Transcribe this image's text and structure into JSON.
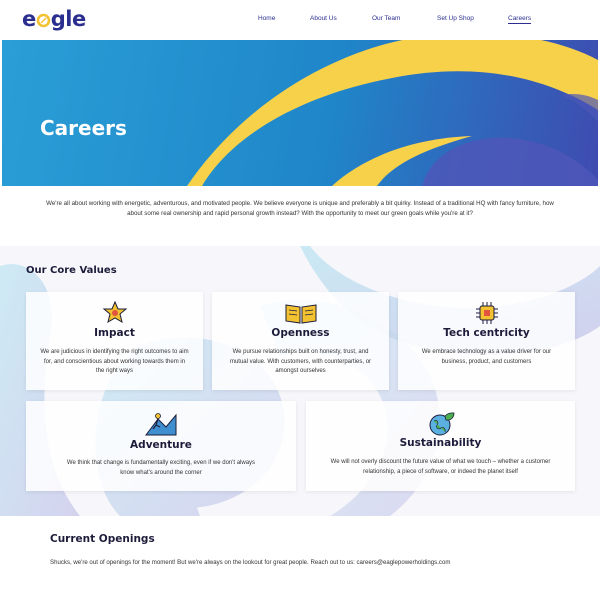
{
  "brand": {
    "logo_text_1": "e",
    "logo_text_2": "g",
    "logo_text_3": "le"
  },
  "nav": {
    "items": [
      {
        "label": "Home"
      },
      {
        "label": "About Us"
      },
      {
        "label": "Our Team"
      },
      {
        "label": "Set Up Shop"
      },
      {
        "label": "Careers",
        "active": true
      }
    ]
  },
  "hero": {
    "title": "Careers"
  },
  "intro": {
    "text": "We're all about working with energetic, adventurous, and motivated people. We believe everyone is unique and preferably a bit quirky. Instead of a traditional HQ with fancy furniture, how about some real ownership and rapid personal growth instead? With the opportunity to meet our green goals while you're at it?"
  },
  "core_values": {
    "title": "Our Core Values",
    "cards": [
      {
        "icon": "trophy-star-icon",
        "title": "Impact",
        "text": "We are judicious in identifying the right outcomes to aim for, and conscientious about working towards them in the right ways"
      },
      {
        "icon": "open-book-icon",
        "title": "Openness",
        "text": "We pursue relationships built on honesty, trust, and mutual value. With customers, with counterparties, or amongst ourselves"
      },
      {
        "icon": "microchip-icon",
        "title": "Tech centricity",
        "text": "We embrace technology as a value driver for our business, product, and customers"
      },
      {
        "icon": "climber-icon",
        "title": "Adventure",
        "text": "We think that change is fundamentally exciting, even if we don't always know what's around the corner"
      },
      {
        "icon": "globe-leaf-icon",
        "title": "Sustainability",
        "text": "We will not overly discount the future value of what we touch – whether a customer relationship, a piece of software, or indeed the planet itself"
      }
    ]
  },
  "openings": {
    "title": "Current Openings",
    "text": "Shucks, we're out of openings for the moment! But we're always on the lookout for great people. Reach out to us: careers@eaglepowerholdings.com"
  },
  "colors": {
    "brand_navy": "#2a2f8f",
    "brand_yellow": "#f2c230",
    "hero_blue": "#1f86c9"
  }
}
